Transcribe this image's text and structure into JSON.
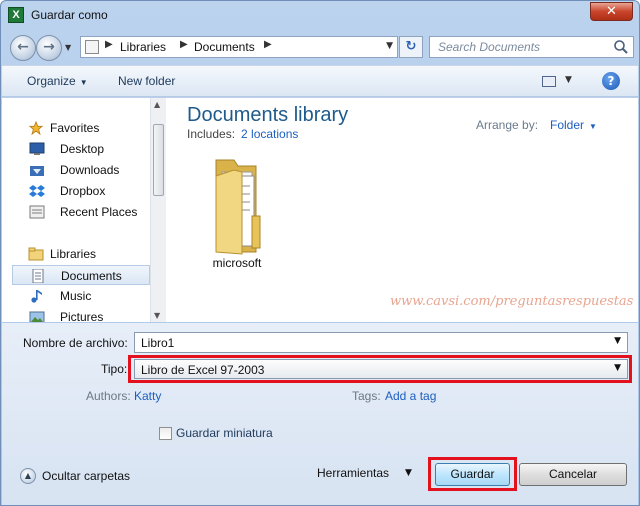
{
  "window": {
    "title": "Guardar como",
    "app_icon": "excel-x-icon",
    "close": "✕"
  },
  "address": {
    "crumbs": [
      "Libraries",
      "Documents"
    ],
    "search_placeholder": "Search Documents"
  },
  "toolbar": {
    "organize": "Organize",
    "new_folder": "New folder"
  },
  "nav": {
    "favorites_label": "Favorites",
    "favorites": [
      "Desktop",
      "Downloads",
      "Dropbox",
      "Recent Places"
    ],
    "libraries_label": "Libraries",
    "libraries": [
      "Documents",
      "Music",
      "Pictures"
    ],
    "selected": "Documents"
  },
  "main": {
    "title": "Documents library",
    "includes_label": "Includes:",
    "includes_link": "2 locations",
    "arrange_label": "Arrange by:",
    "arrange_value": "Folder",
    "folder_name": "microsoft",
    "watermark": "www.cavsi.com/preguntasrespuestas"
  },
  "form": {
    "filename_label": "Nombre de archivo:",
    "filename_value": "Libro1",
    "type_label": "Tipo:",
    "type_value": "Libro de Excel 97-2003",
    "authors_label": "Authors:",
    "authors_value": "Katty",
    "tags_label": "Tags:",
    "tags_value": "Add a tag",
    "thumbnail_label": "Guardar miniatura",
    "thumbnail_checked": false
  },
  "footer": {
    "hide_folders": "Ocultar carpetas",
    "tools": "Herramientas",
    "save": "Guardar",
    "cancel": "Cancelar"
  },
  "colors": {
    "highlight_border": "#e2111d",
    "link": "#1d5fbf",
    "title": "#1e5a8c"
  }
}
